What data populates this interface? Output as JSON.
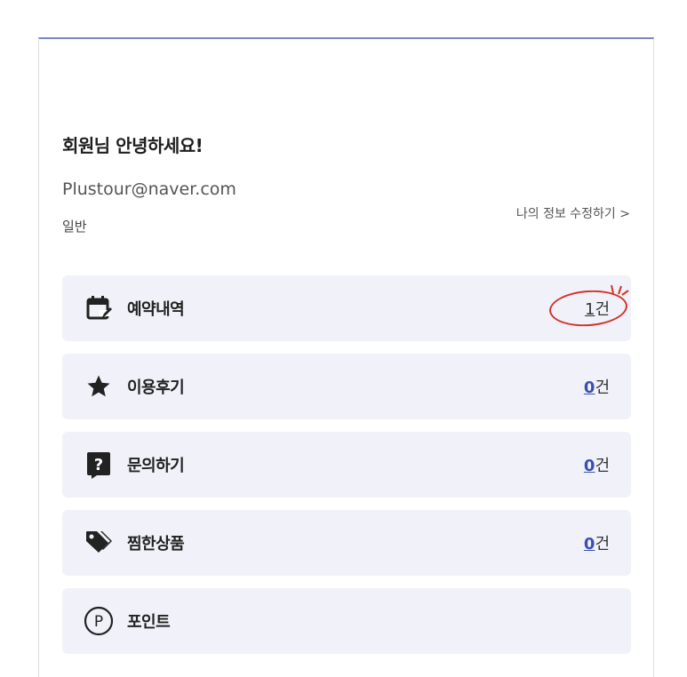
{
  "profile": {
    "greeting": "회원님 안녕하세요!",
    "email": "Plustour@naver.com",
    "grade": "일반",
    "edit_link": "나의 정보 수정하기 >"
  },
  "menu": [
    {
      "label": "예약내역",
      "icon": "calendar-edit-icon",
      "count_num": "1",
      "count_unit": "건",
      "highlighted": true
    },
    {
      "label": "이용후기",
      "icon": "star-icon",
      "count_num": "0",
      "count_unit": "건"
    },
    {
      "label": "문의하기",
      "icon": "question-icon",
      "count_num": "0",
      "count_unit": "건"
    },
    {
      "label": "찜한상품",
      "icon": "tag-icon",
      "count_num": "0",
      "count_unit": "건"
    },
    {
      "label": "포인트",
      "icon": "point-icon"
    }
  ],
  "colors": {
    "accent": "#3b4fb3",
    "menu_bg": "#f1f2f9",
    "annotation": "#d0342c"
  }
}
